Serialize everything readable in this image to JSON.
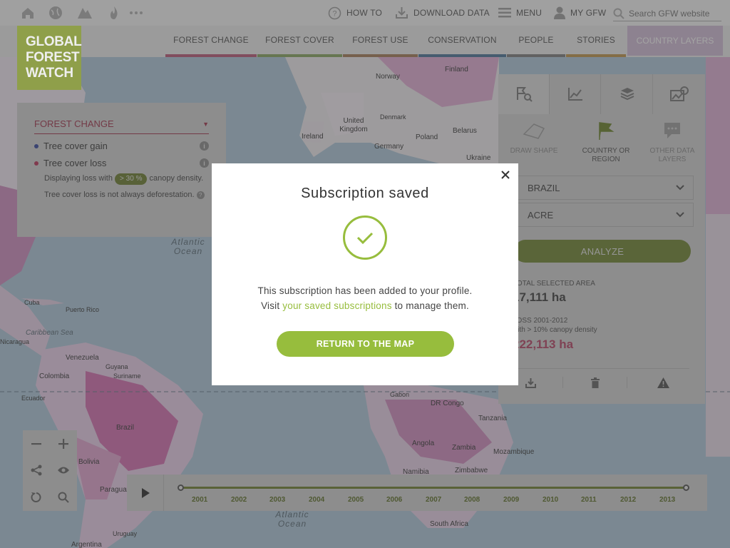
{
  "topbar": {
    "how_to": "HOW TO",
    "download_data": "DOWNLOAD DATA",
    "menu": "MENU",
    "my_gfw": "MY GFW",
    "search_placeholder": "Search GFW website"
  },
  "logo": {
    "line1": "GLOBAL",
    "line2": "FOREST",
    "line3": "WATCH"
  },
  "nav": {
    "tabs": [
      {
        "label": "FOREST CHANGE",
        "color": "#c0426d"
      },
      {
        "label": "FOREST COVER",
        "color": "#7fa24a"
      },
      {
        "label": "FOREST USE",
        "color": "#a8683e"
      },
      {
        "label": "CONSERVATION",
        "color": "#3c6e9a"
      },
      {
        "label": "PEOPLE",
        "color": "#6f6f6f"
      },
      {
        "label": "STORIES",
        "color": "#c08a2e"
      }
    ],
    "country_layers": "COUNTRY LAYERS"
  },
  "legend": {
    "title": "FOREST CHANGE",
    "items": [
      {
        "label": "Tree cover gain",
        "color": "#3c4a9a"
      },
      {
        "label": "Tree cover loss",
        "color": "#b23a5c"
      }
    ],
    "displaying_prefix": "Displaying loss with",
    "canopy_pill": "> 30 %",
    "displaying_suffix": "canopy density.",
    "note": "Tree cover loss is not always deforestation."
  },
  "analysis": {
    "options": [
      {
        "label": "DRAW SHAPE",
        "icon": "draw-shape-icon"
      },
      {
        "label": "COUNTRY OR REGION",
        "icon": "flag-icon"
      },
      {
        "label": "OTHER DATA LAYERS",
        "icon": "speech-bubble-icon"
      }
    ],
    "country": "BRAZIL",
    "region": "ACRE",
    "analyze": "ANALYZE",
    "total_area_label": "TOTAL SELECTED AREA",
    "total_area_value": "17,111 ha",
    "loss_label": "LOSS 2001-2012",
    "loss_sublabel": "with > 10% canopy density",
    "loss_value": "222,113 ha"
  },
  "timeline": {
    "years": [
      "2001",
      "2002",
      "2003",
      "2004",
      "2005",
      "2006",
      "2007",
      "2008",
      "2009",
      "2010",
      "2011",
      "2012",
      "2013"
    ]
  },
  "map_labels": [
    {
      "text": "Norway"
    },
    {
      "text": "Finland"
    },
    {
      "text": "Denmark"
    },
    {
      "text": "United Kingdom"
    },
    {
      "text": "Ireland"
    },
    {
      "text": "Poland"
    },
    {
      "text": "Belarus"
    },
    {
      "text": "Germany"
    },
    {
      "text": "Ukraine"
    },
    {
      "text": "Cuba"
    },
    {
      "text": "Puerto Rico"
    },
    {
      "text": "Nicaragua"
    },
    {
      "text": "Venezuela"
    },
    {
      "text": "Guyana"
    },
    {
      "text": "Suriname"
    },
    {
      "text": "Colombia"
    },
    {
      "text": "Ecuador"
    },
    {
      "text": "Brazil"
    },
    {
      "text": "Bolivia"
    },
    {
      "text": "Paraguay"
    },
    {
      "text": "Uruguay"
    },
    {
      "text": "Argentina"
    },
    {
      "text": "Gabon"
    },
    {
      "text": "DR Congo"
    },
    {
      "text": "Tanzania"
    },
    {
      "text": "Angola"
    },
    {
      "text": "Zambia"
    },
    {
      "text": "Mozambique"
    },
    {
      "text": "Namibia"
    },
    {
      "text": "Zimbabwe"
    },
    {
      "text": "South Africa"
    },
    {
      "text": "Caribbean Sea"
    }
  ],
  "oceans": [
    "Atlantic Ocean",
    "Atlantic Ocean"
  ],
  "modal": {
    "title": "Subscription saved",
    "line1": "This subscription has been added to your profile.",
    "visit": "Visit",
    "link": "your saved subscriptions",
    "manage": "to manage them.",
    "button": "RETURN TO THE MAP"
  }
}
